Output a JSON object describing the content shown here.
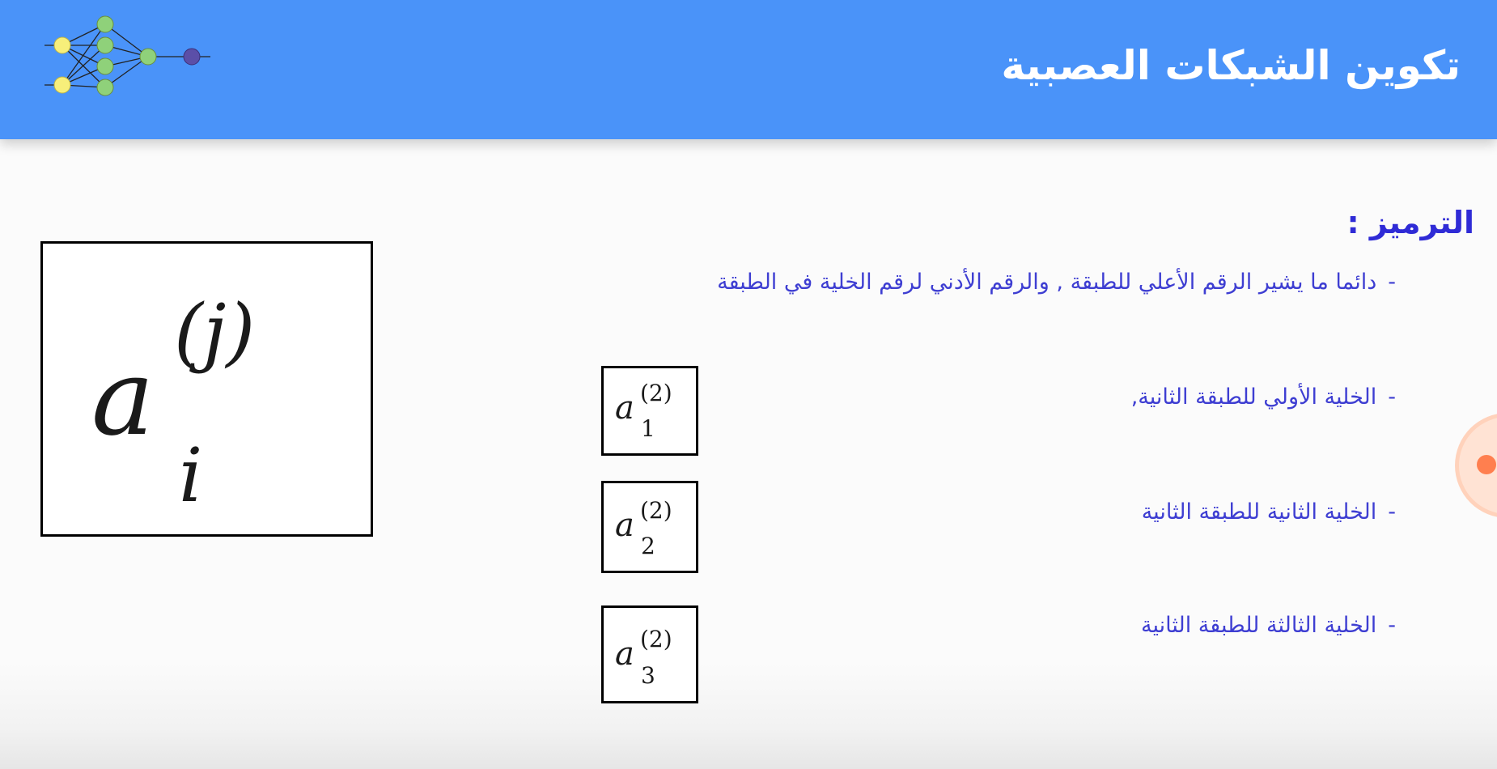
{
  "slide": {
    "title": "تكوين الشبكات العصبية",
    "section_heading": "الترميز :",
    "bullets": [
      {
        "dash": "-",
        "text": "دائما ما يشير الرقم الأعلي للطبقة , والرقم الأدني لرقم الخلية في الطبقة"
      },
      {
        "dash": "-",
        "text": "الخلية الأولي للطبقة الثانية,"
      },
      {
        "dash": "-",
        "text": "الخلية الثانية للطبقة الثانية"
      },
      {
        "dash": "-",
        "text": "الخلية الثالثة للطبقة الثانية"
      }
    ],
    "general_notation": {
      "base": "a",
      "superscript": "(j)",
      "subscript": "i"
    },
    "examples": [
      {
        "base": "a",
        "superscript": "(2)",
        "subscript": "1"
      },
      {
        "base": "a",
        "superscript": "(2)",
        "subscript": "2"
      },
      {
        "base": "a",
        "superscript": "(2)",
        "subscript": "3"
      }
    ]
  },
  "colors": {
    "header": "#4a93f9",
    "bullet_text": "#3e3ed2",
    "heading_text": "#2f2bd6",
    "input_neuron": "#f7ef7a",
    "hidden_neuron": "#8fd17a",
    "output_neuron": "#5b4fa8"
  },
  "icons": {
    "logo": "neural-network-icon",
    "side_button": "record-dot-icon"
  }
}
